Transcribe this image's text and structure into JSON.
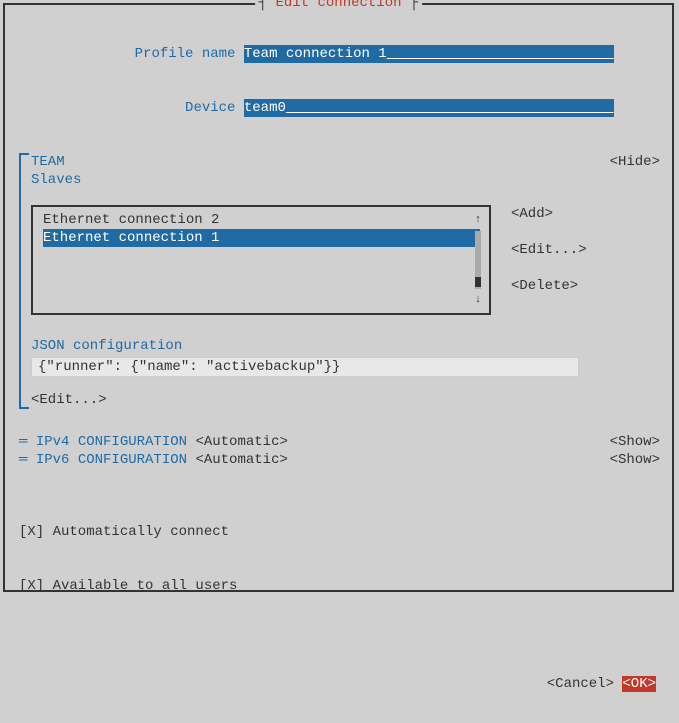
{
  "title": "Edit connection",
  "profile": {
    "label": "Profile name",
    "value": "Team connection 1",
    "padded": "Team connection 1                           "
  },
  "device": {
    "label": "Device",
    "value": "team0",
    "padded": "team0                                       "
  },
  "team": {
    "heading": "TEAM",
    "slaves_label": "Slaves",
    "hide": "<Hide>",
    "items": [
      {
        "label": "Ethernet connection 2",
        "selected": false,
        "padded": "Ethernet connection 2"
      },
      {
        "label": "Ethernet connection 1",
        "selected": true,
        "padded": "Ethernet connection 1                               "
      }
    ],
    "buttons": {
      "add": "<Add>",
      "edit": "<Edit...>",
      "delete": "<Delete>"
    },
    "json_label": "JSON configuration",
    "json_value": "{\"runner\": {\"name\": \"activebackup\"}}",
    "edit": "<Edit...>"
  },
  "ipv4": {
    "label": "IPv4 CONFIGURATION",
    "mode": "<Automatic>",
    "action": "<Show>"
  },
  "ipv6": {
    "label": "IPv6 CONFIGURATION",
    "mode": "<Automatic>",
    "action": "<Show>"
  },
  "checks": {
    "auto": "[X] Automatically connect",
    "all_users": "[X] Available to all users"
  },
  "footer": {
    "cancel": "<Cancel>",
    "ok": "<OK>"
  }
}
